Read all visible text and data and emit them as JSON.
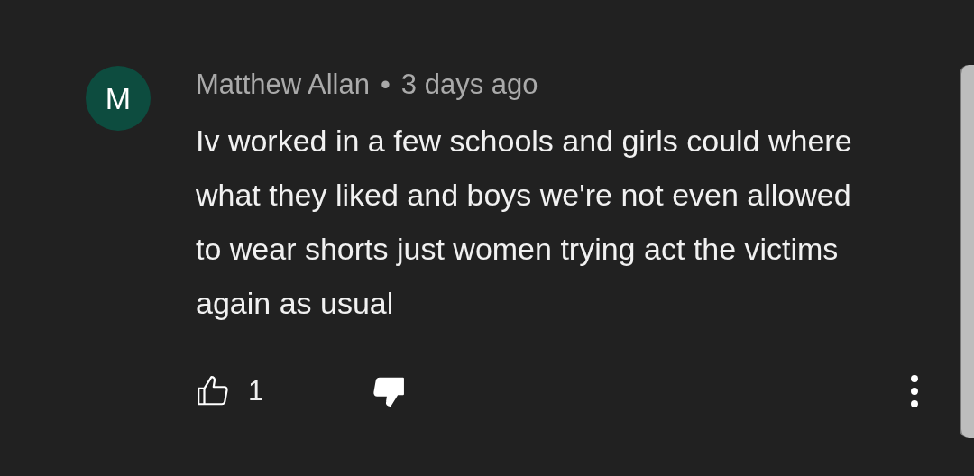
{
  "comment": {
    "avatar_letter": "M",
    "author": "Matthew Allan",
    "separator": "•",
    "time": "3 days ago",
    "text": "Iv worked in a few schools and girls could where what they liked and boys we're not even allowed to wear shorts just women trying act the victims again as usual",
    "like_count": "1",
    "liked": false,
    "disliked": true
  }
}
